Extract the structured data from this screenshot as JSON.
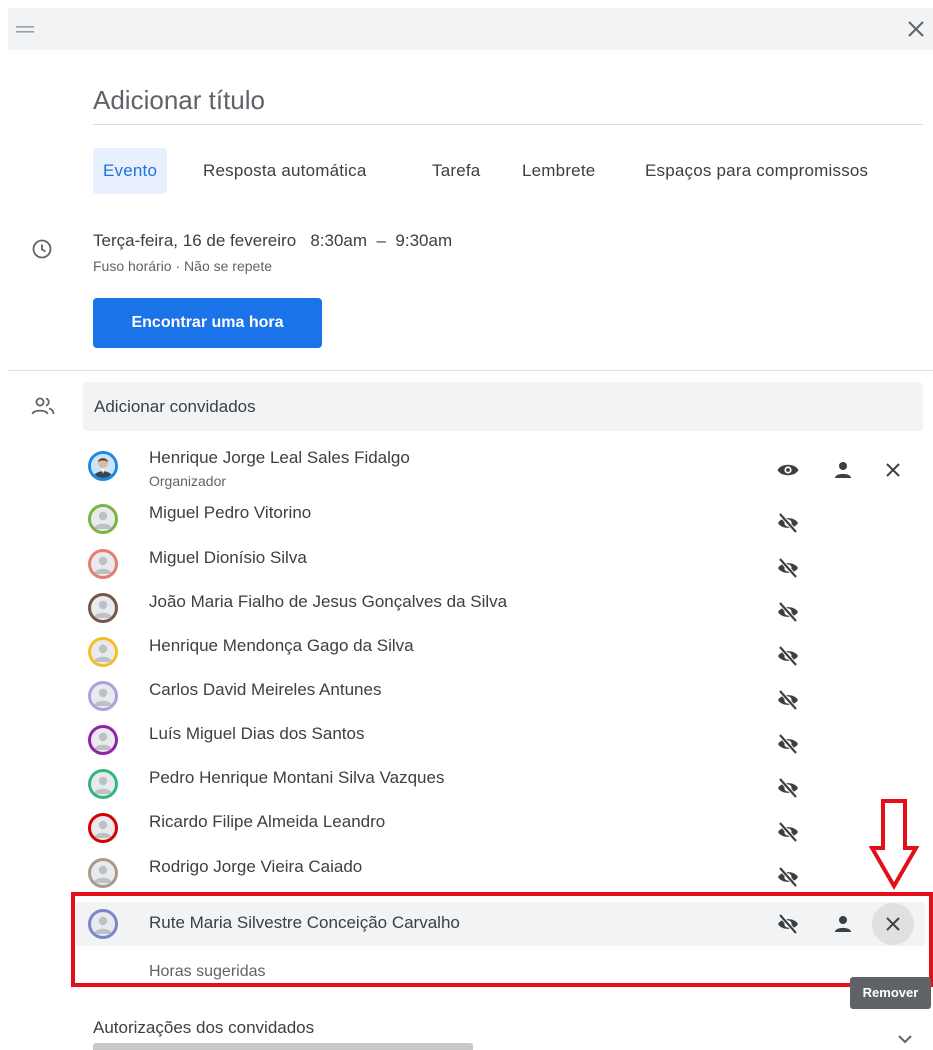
{
  "topbar": {
    "drag_icon": "drag-handle-icon",
    "close_icon": "close-icon"
  },
  "title": {
    "placeholder": "Adicionar título"
  },
  "tabs": [
    {
      "label": "Evento",
      "active": true
    },
    {
      "label": "Resposta automática",
      "active": false
    },
    {
      "label": "Tarefa",
      "active": false
    },
    {
      "label": "Lembrete",
      "active": false
    },
    {
      "label": "Espaços para compromissos",
      "active": false
    }
  ],
  "time": {
    "date": "Terça-feira, 16 de fevereiro",
    "start": "8:30am",
    "separator": "–",
    "end": "9:30am",
    "timezone": "Fuso horário",
    "dot": "·",
    "repeat": "Não se repete",
    "find_button": "Encontrar uma hora"
  },
  "guests": {
    "placeholder": "Adicionar convidados",
    "list": [
      {
        "name": "Henrique Jorge Leal Sales Fidalgo",
        "role": "Organizador",
        "ring": "#1e88e5",
        "photo": true
      },
      {
        "name": "Miguel Pedro Vitorino",
        "ring": "#7cb342"
      },
      {
        "name": "Miguel Dionísio Silva",
        "ring": "#e67c73"
      },
      {
        "name": "João Maria Fialho de Jesus Gonçalves da Silva",
        "ring": "#795548"
      },
      {
        "name": "Henrique Mendonça Gago da Silva",
        "ring": "#f6bf26"
      },
      {
        "name": "Carlos David Meireles Antunes",
        "ring": "#b39ddb"
      },
      {
        "name": "Luís Miguel Dias dos Santos",
        "ring": "#8e24aa"
      },
      {
        "name": "Pedro Henrique Montani Silva Vazques",
        "ring": "#33b679"
      },
      {
        "name": "Ricardo Filipe Almeida Leandro",
        "ring": "#d50000"
      },
      {
        "name": "Rodrigo Jorge Vieira Caiado",
        "ring": "#a79b8e"
      },
      {
        "name": "Rute Maria Silvestre Conceição Carvalho",
        "ring": "#7986cb"
      }
    ],
    "suggested_times": "Horas sugeridas",
    "remove_tooltip": "Remover"
  },
  "permissions": {
    "label": "Autorizações dos convidados"
  },
  "colors": {
    "accent": "#1a73e8",
    "highlight": "#e3101a"
  }
}
